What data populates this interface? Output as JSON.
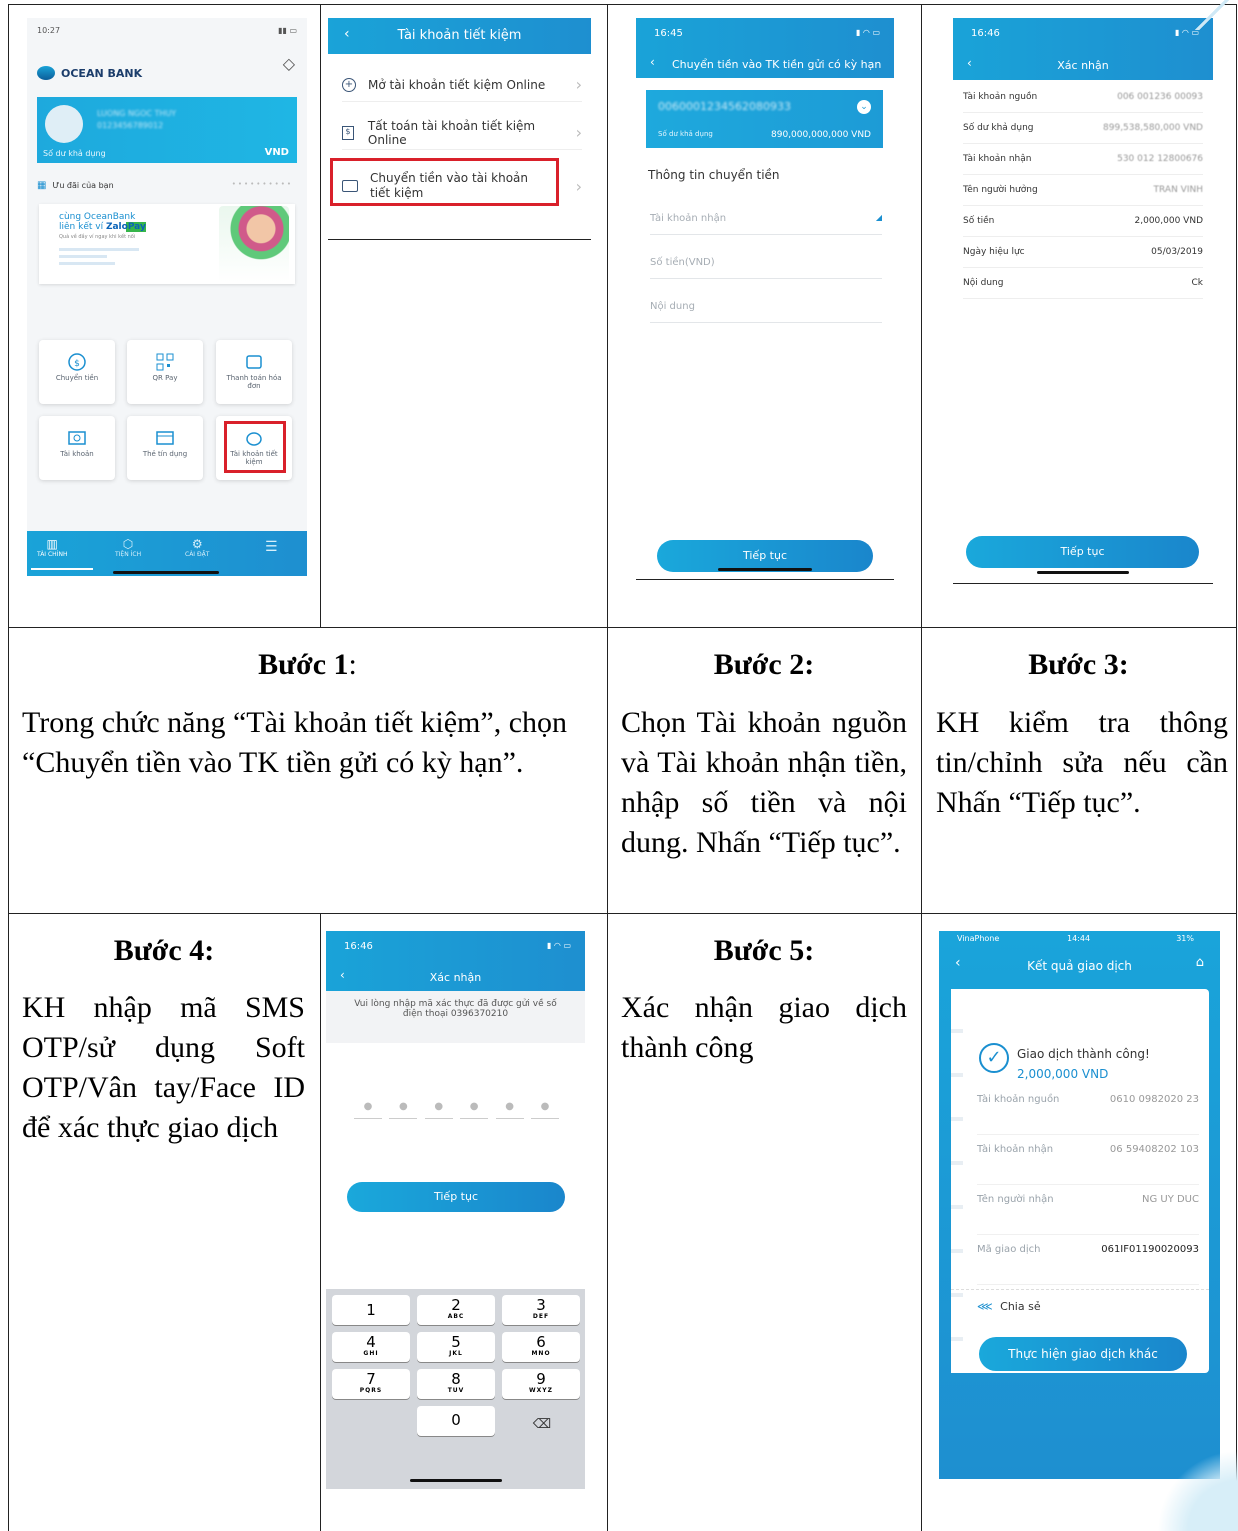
{
  "steps": {
    "s1": {
      "title": "Bước 1",
      "title_suffix": ":",
      "text": "Trong chức năng “Tài khoản tiết kiệm”, chọn “Chuyển tiền vào TK tiền gửi có kỳ hạn”."
    },
    "s2": {
      "title": "Bước 2:",
      "text": "Chọn Tài khoản nguồn và Tài khoản nhận tiền, nhập số tiền và nội dung. Nhấn “Tiếp tục”."
    },
    "s3": {
      "title": "Bước 3:",
      "text": "KH kiểm tra thông tin/chỉnh sửa nếu cần Nhấn “Tiếp tục”."
    },
    "s4": {
      "title": "Bước 4:",
      "text": "KH nhập mã SMS OTP/sử dụng Soft OTP/Vân tay/Face ID để xác thực giao dịch"
    },
    "s5": {
      "title": "Bước 5:",
      "text": "Xác nhận giao dịch thành công"
    }
  },
  "screen1": {
    "time": "10:27",
    "bank": "OCEAN BANK",
    "account_name": "LUONG NGOC THUY",
    "account_no": "0123456789012",
    "balance_label": "Số dư khả dụng",
    "balance_value": "VND",
    "offers_label": "Ưu đãi của bạn",
    "promo_line1": "cùng OceanBank",
    "promo_line2": "liên kết ví",
    "promo_brand": "ZaloPay",
    "promo_sub": "Quà về đầy ví ngay khi kết nối",
    "tiles": [
      "Chuyển tiền",
      "QR Pay",
      "Thanh toán hóa đơn",
      "Tài khoản",
      "Thẻ tín dụng",
      "Tài khoản tiết kiệm"
    ],
    "nav": [
      "TÀI CHÍNH",
      "TIỆN ÍCH",
      "CÀI ĐẶT"
    ]
  },
  "screen2": {
    "title": "Tài khoản tiết kiệm",
    "items": [
      "Mở tài khoản tiết kiệm Online",
      "Tất toán tài khoản tiết kiệm Online",
      "Chuyển tiền vào tài khoản tiết kiệm"
    ]
  },
  "screen3": {
    "time": "16:45",
    "title": "Chuyển tiền vào TK tiền gửi có kỳ hạn",
    "account": "0060001234562080933",
    "balance_label": "Số dư khả dụng",
    "balance_value": "890,000,000,000 VND",
    "section": "Thông tin chuyển tiền",
    "fields": [
      "Tài khoản nhận",
      "Số tiền(VND)",
      "Nội dung"
    ],
    "button": "Tiếp tục"
  },
  "screen4": {
    "time": "16:46",
    "title": "Xác nhận",
    "rows": [
      {
        "k": "Tài khoản nguồn",
        "v": "006 001236 00093"
      },
      {
        "k": "Số dư khả dụng",
        "v": "899,538,580,000 VND"
      },
      {
        "k": "Tài khoản nhận",
        "v": "530 012 12800676"
      },
      {
        "k": "Tên người hưởng",
        "v": "TRAN VINH"
      },
      {
        "k": "Số tiền",
        "v": "2,000,000 VND"
      },
      {
        "k": "Ngày hiệu lực",
        "v": "05/03/2019"
      },
      {
        "k": "Nội dung",
        "v": "Ck"
      }
    ],
    "button": "Tiếp tục"
  },
  "screen5": {
    "time": "16:46",
    "title": "Xác nhận",
    "message": "Vui lòng nhập mã xác thực đã được gửi về số điện thoại 0396370210",
    "button": "Tiếp tục",
    "keys": [
      {
        "d": "1",
        "l": ""
      },
      {
        "d": "2",
        "l": "ABC"
      },
      {
        "d": "3",
        "l": "DEF"
      },
      {
        "d": "4",
        "l": "GHI"
      },
      {
        "d": "5",
        "l": "JKL"
      },
      {
        "d": "6",
        "l": "MNO"
      },
      {
        "d": "7",
        "l": "PQRS"
      },
      {
        "d": "8",
        "l": "TUV"
      },
      {
        "d": "9",
        "l": "WXYZ"
      },
      {
        "d": "0",
        "l": ""
      }
    ]
  },
  "screen6": {
    "carrier": "VinaPhone",
    "time": "14:44",
    "battery": "31%",
    "title": "Kết quả giao dịch",
    "success": "Giao dịch thành công!",
    "amount": "2,000,000 VND",
    "rows": [
      {
        "k": "Tài khoản nguồn",
        "v": "0610 0982020 23"
      },
      {
        "k": "Tài khoản nhận",
        "v": "06 59408202 103"
      },
      {
        "k": "Tên người nhận",
        "v": "NG UY DUC"
      },
      {
        "k": "Mã giao dịch",
        "v": "061IF01190020093"
      }
    ],
    "share": "Chia sẻ",
    "button": "Thực hiện giao dịch khác"
  }
}
